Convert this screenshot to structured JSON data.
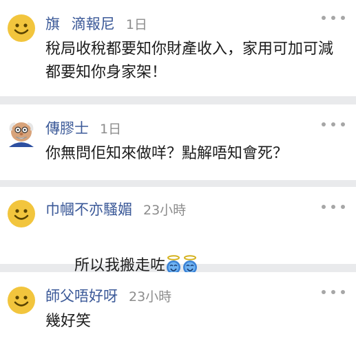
{
  "comments": [
    {
      "author": "旗滴報尼",
      "time": "1日",
      "text": "稅局收稅都要知你財產收入，家用可加可減都要知你身家架！",
      "avatar": "smiley-icon"
    },
    {
      "author": "傳膠士",
      "time": "1日",
      "text": "你無問佢知來做咩？點解唔知會死？",
      "avatar": "old-man-avatar"
    },
    {
      "author": "巾幗不亦騷媚",
      "time": "23小時",
      "text": "所以我搬走咗",
      "avatar": "smiley-icon",
      "emoji": "halo-smiley-icon"
    },
    {
      "author": "師父唔好呀",
      "time": "23小時",
      "text": "幾好笑",
      "avatar": "smiley-icon"
    }
  ],
  "colors": {
    "author": "#3b5998",
    "time": "#8c8c8c",
    "divider": "#e9eaec",
    "smiley": "#f2c53d"
  }
}
